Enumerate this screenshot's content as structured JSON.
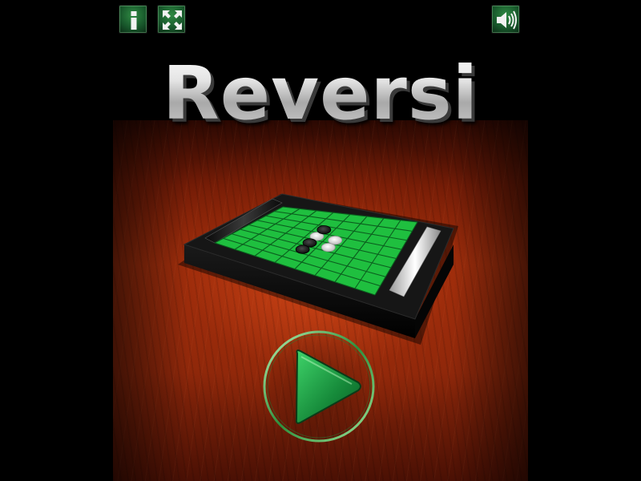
{
  "game": {
    "title": "Reversi"
  },
  "toolbar": {
    "info_icon": "info-icon",
    "fullscreen_icon": "fullscreen-icon",
    "sound_icon": "speaker-icon"
  },
  "main": {
    "play_icon": "play-icon"
  },
  "board": {
    "size": 8,
    "pieces": [
      {
        "row": 3,
        "col": 3,
        "color": "white"
      },
      {
        "row": 3,
        "col": 4,
        "color": "white"
      },
      {
        "row": 4,
        "col": 3,
        "color": "black"
      },
      {
        "row": 4,
        "col": 4,
        "color": "white"
      },
      {
        "row": 2,
        "col": 3,
        "color": "black"
      },
      {
        "row": 5,
        "col": 3,
        "color": "black"
      }
    ]
  },
  "colors": {
    "board_green": "#1fbf3f",
    "board_frame": "#0d0d0d",
    "button_green": "#1e6e34",
    "play_green": "#22a04a",
    "wood": "#8a260a"
  }
}
